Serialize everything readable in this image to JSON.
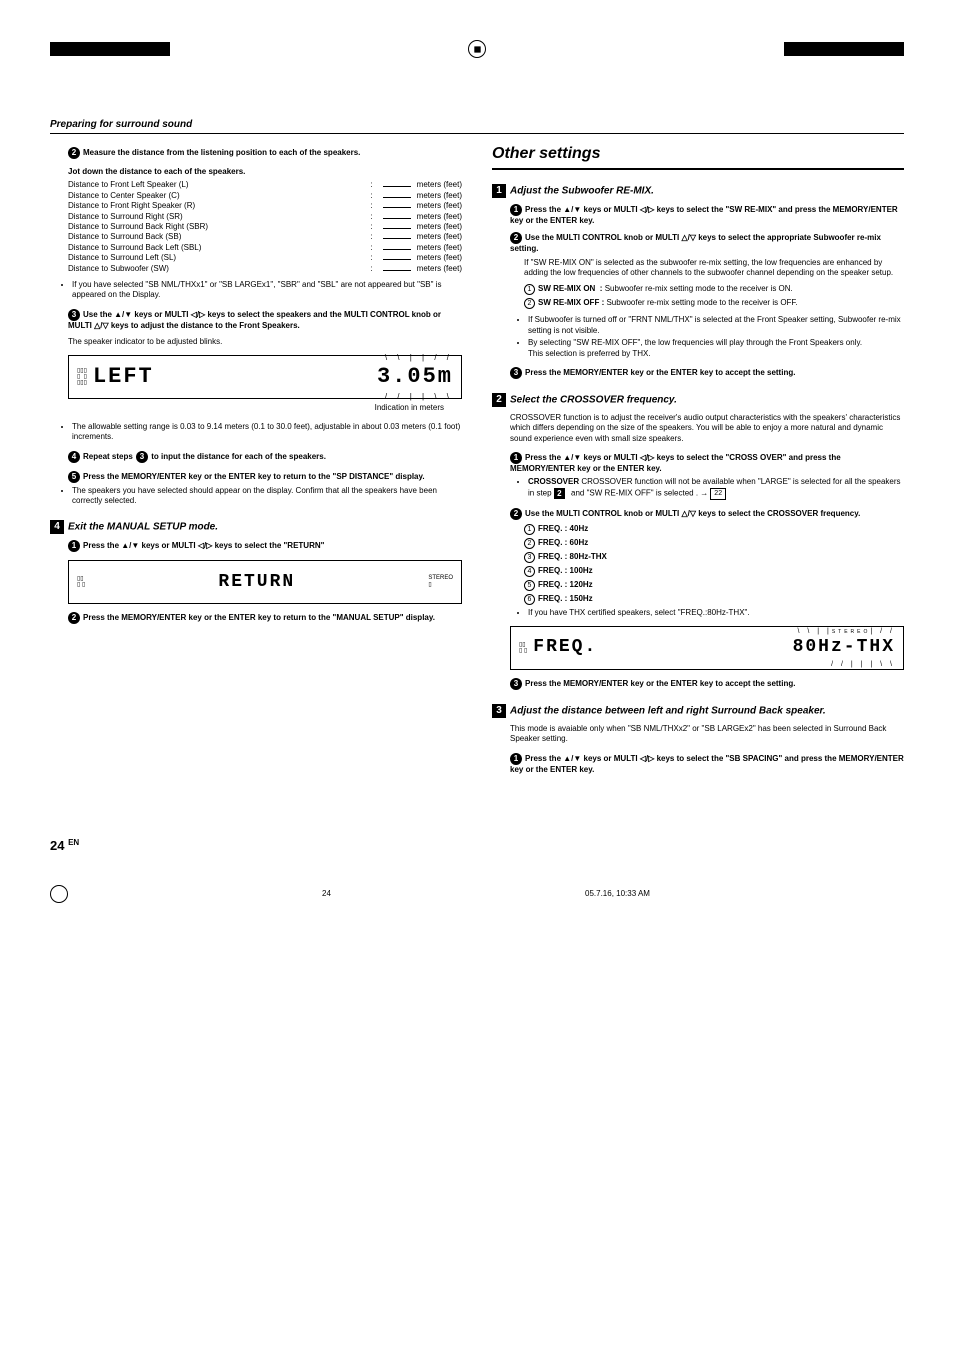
{
  "header": {
    "title": "Preparing for surround sound"
  },
  "col1": {
    "step2_text": "Measure the distance from the listening position to each of the speakers.",
    "jot_title": "Jot down the distance to each of the speakers.",
    "distances": [
      "Distance to Front Left Speaker (L)",
      "Distance to Center Speaker (C)",
      "Distance to Front Right Speaker (R)",
      "Distance to Surround Right (SR)",
      "Distance to Surround Back Right (SBR)",
      "Distance to Surround Back (SB)",
      "Distance to Surround Back Left (SBL)",
      "Distance to Surround Left (SL)",
      "Distance to Subwoofer (SW)"
    ],
    "unit": "meters (feet)",
    "note_sb": "If you have selected \"SB NML/THXx1\" or \"SB LARGEx1\", \"SBR\" and \"SBL\" are not appeared but \"SB\" is appeared on the Display.",
    "step3_text": "Use the ▲/▼ keys or MULTI ◁/▷ keys to select the speakers and the MULTI CONTROL knob or MULTI △/▽ keys to adjust the distance to the Front Speakers.",
    "blink_text": "The speaker indicator to be adjusted blinks.",
    "lcd1_left": "LEFT",
    "lcd1_right": "3.05m",
    "caption1": "Indication in meters",
    "range_note": "The allowable setting range is  0.03 to 9.14 meters (0.1 to 30.0 feet), adjustable in about 0.03 meters (0.1 foot) increments.",
    "step4_text": "Repeat steps 3 to input the distance for each of the speakers.",
    "step5_text": "Press the MEMORY/ENTER key or the ENTER key to return to the \"SP DISTANCE\" display.",
    "step5_note": "The speakers you have selected should appear on the display. Confirm that all the speakers have been correctly selected.",
    "exit_head": "Exit the MANUAL SETUP mode.",
    "exit1": "Press the ▲/▼ keys or MULTI ◁/▷ keys to select the \"RETURN\"",
    "lcd2": "RETURN",
    "exit2": "Press the MEMORY/ENTER key or the ENTER key to return to the \"MANUAL SETUP\" display."
  },
  "col2": {
    "other_head": "Other settings",
    "s1_head": "Adjust the Subwoofer RE-MIX.",
    "s1_1": "Press the ▲/▼ keys or MULTI ◁/▷ keys to select the \"SW RE-MIX\" and press the MEMORY/ENTER key or the ENTER key.",
    "s1_2": "Use the MULTI CONTROL knob or MULTI △/▽ keys to select the appropriate Subwoofer re-mix setting.",
    "s1_if": "If \"SW RE-MIX ON\" is selected as the subwoofer re-mix setting, the low frequencies are enhanced by adding the low frequencies of other channels to the subwoofer channel depending on the speaker setup.",
    "s1_on_label": "SW RE-MIX ON",
    "s1_on_desc": "Subwoofer re-mix setting mode to the receiver is ON.",
    "s1_off_label": "SW RE-MIX OFF",
    "s1_off_desc": "Subwoofer re-mix setting mode to the receiver is OFF.",
    "s1_b1": "If Subwoofer is turned off or \"FRNT NML/THX\" is selected at the Front Speaker setting, Subwoofer re-mix setting is not visible.",
    "s1_b2": "By selecting \"SW RE-MIX OFF\", the low frequencies will play through the Front Speakers only.",
    "s1_b2b": "This selection is preferred by THX.",
    "s1_3": "Press the MEMORY/ENTER key or the ENTER key to accept the setting.",
    "s2_head": "Select the CROSSOVER frequency.",
    "s2_intro": "CROSSOVER function is to adjust the receiver's audio output characteristics with the speakers' characteristics which differs depending on the size of the speakers. You will be able to enjoy a more natural and dynamic sound experience even with small size speakers.",
    "s2_1": "Press the ▲/▼ keys or MULTI ◁/▷ keys to select the \"CROSS OVER\" and press the MEMORY/ENTER key or the ENTER key.",
    "s2_1note_a": "CROSSOVER function will not be available when \"LARGE\" is selected for all the speakers in step ",
    "s2_1note_b": " and \"SW RE-MIX OFF\" is selected .",
    "s2_ref": "22",
    "s2_2": "Use the MULTI CONTROL knob or MULTI △/▽ keys to select the CROSSOVER frequency.",
    "freqs": [
      "FREQ. : 40Hz",
      "FREQ. : 60Hz",
      "FREQ. : 80Hz-THX",
      "FREQ. : 100Hz",
      "FREQ. : 120Hz",
      "FREQ. : 150Hz"
    ],
    "s2_thx": "If you have THX certified speakers, select \"FREQ.:80Hz-THX\".",
    "lcd3a": "FREQ.",
    "lcd3b": "80Hz-THX",
    "s2_3": "Press the MEMORY/ENTER key or the ENTER key to accept the setting.",
    "s3_head": "Adjust the distance between left and right Surround Back speaker.",
    "s3_intro": "This mode is avaiable only when \"SB NML/THXx2\" or \"SB LARGEx2\" has been selected in Surround Back Speaker setting.",
    "s3_1": "Press the ▲/▼ keys or MULTI ◁/▷ keys to select the \"SB SPACING\" and press the MEMORY/ENTER key or the ENTER key."
  },
  "footer": {
    "page": "24",
    "en": "EN",
    "pgnum": "24",
    "ts": "05.7.16, 10:33 AM"
  }
}
